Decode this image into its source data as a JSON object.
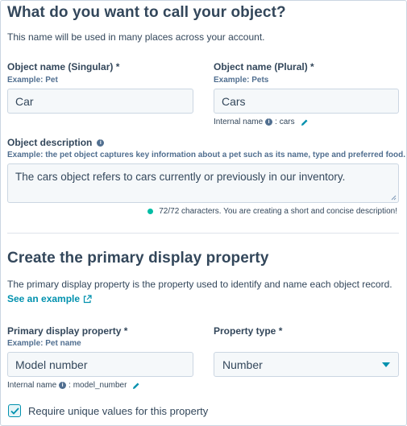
{
  "section1": {
    "title": "What do you want to call your object?",
    "description": "This name will be used in many places across your account.",
    "singular": {
      "label": "Object name (Singular) *",
      "example": "Example: Pet",
      "value": "Car"
    },
    "plural": {
      "label": "Object name (Plural) *",
      "example": "Example: Pets",
      "value": "Cars",
      "internal_name_label": "Internal name",
      "internal_name_value": ": cars"
    },
    "object_description": {
      "label": "Object description",
      "example": "Example: the pet object captures key information about a pet such as its name, type and preferred food.",
      "value": "The cars object refers to cars currently or previously in our inventory.",
      "status": "72/72 characters. You are creating a short and concise description!",
      "status_color": "#00bda5"
    }
  },
  "section2": {
    "title": "Create the primary display property",
    "description": "The primary display property is the property used to identify and name each object record.",
    "see_example_link": "See an example",
    "primary_property": {
      "label": "Primary display property *",
      "example": "Example: Pet name",
      "value": "Model number",
      "internal_name_label": "Internal name",
      "internal_name_value": ": model_number"
    },
    "property_type": {
      "label": "Property type *",
      "selected": "Number"
    },
    "unique_checkbox": {
      "label": "Require unique values for this property",
      "checked": true
    }
  },
  "icons": {
    "info": "info-icon",
    "edit": "pencil-icon",
    "external": "external-link-icon",
    "dropdown": "caret-down-icon",
    "check": "checkmark-icon"
  },
  "colors": {
    "text": "#33475b",
    "accent": "#0091ae",
    "success": "#00bda5",
    "input_bg": "#f5f8fa",
    "border": "#cbd6e2"
  }
}
